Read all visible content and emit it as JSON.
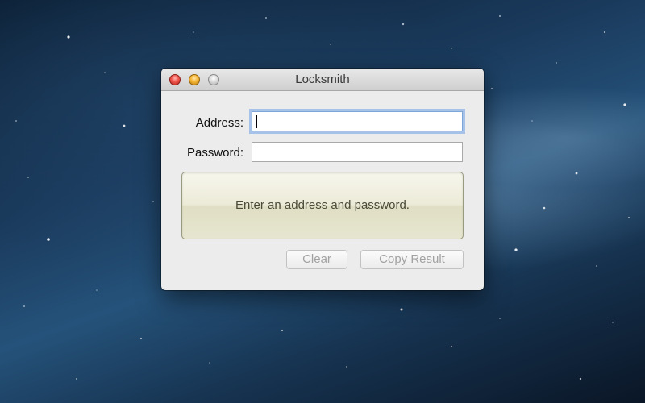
{
  "window": {
    "title": "Locksmith"
  },
  "form": {
    "address_label": "Address:",
    "address_value": "",
    "password_label": "Password:",
    "password_value": ""
  },
  "result": {
    "message": "Enter an address and password."
  },
  "buttons": {
    "clear_label": "Clear",
    "copy_label": "Copy Result"
  },
  "colors": {
    "close": "#f0544b",
    "minimize": "#f5b634",
    "zoom": "#d8d8d8",
    "focus_ring": "#6ea0e6"
  }
}
